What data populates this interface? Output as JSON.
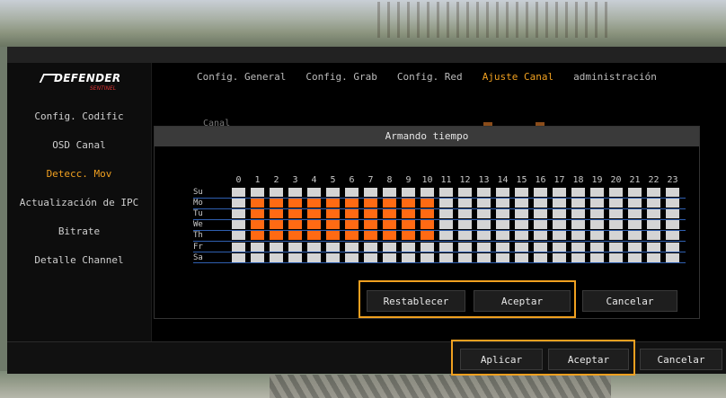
{
  "logo": {
    "brand": "DEFENDER",
    "sub": "SENTINEL"
  },
  "nav": {
    "tabs": [
      {
        "label": "Config. General",
        "active": false
      },
      {
        "label": "Config. Grab",
        "active": false
      },
      {
        "label": "Config. Red",
        "active": false
      },
      {
        "label": "Ajuste Canal",
        "active": true
      },
      {
        "label": "administración",
        "active": false
      }
    ]
  },
  "sidebar": {
    "items": [
      {
        "label": "Config. Codific",
        "active": false
      },
      {
        "label": "OSD Canal",
        "active": false
      },
      {
        "label": "Detecc. Mov",
        "active": true
      },
      {
        "label": "Actualización de IPC",
        "active": false
      },
      {
        "label": "Bitrate",
        "active": false
      },
      {
        "label": "Detalle Channel",
        "active": false
      }
    ]
  },
  "background_field_label": "Canal",
  "dialog": {
    "title": "Armando tiempo",
    "hours": [
      "0",
      "1",
      "2",
      "3",
      "4",
      "5",
      "6",
      "7",
      "8",
      "9",
      "10",
      "11",
      "12",
      "13",
      "14",
      "15",
      "16",
      "17",
      "18",
      "19",
      "20",
      "21",
      "22",
      "23"
    ],
    "days": [
      "Su",
      "Mo",
      "Tu",
      "We",
      "Th",
      "Fr",
      "Sa"
    ],
    "schedule": [
      [
        0,
        0,
        0,
        0,
        0,
        0,
        0,
        0,
        0,
        0,
        0,
        0,
        0,
        0,
        0,
        0,
        0,
        0,
        0,
        0,
        0,
        0,
        0,
        0
      ],
      [
        0,
        1,
        1,
        1,
        1,
        1,
        1,
        1,
        1,
        1,
        1,
        0,
        0,
        0,
        0,
        0,
        0,
        0,
        0,
        0,
        0,
        0,
        0,
        0
      ],
      [
        0,
        1,
        1,
        1,
        1,
        1,
        1,
        1,
        1,
        1,
        1,
        0,
        0,
        0,
        0,
        0,
        0,
        0,
        0,
        0,
        0,
        0,
        0,
        0
      ],
      [
        0,
        1,
        1,
        1,
        1,
        1,
        1,
        1,
        1,
        1,
        1,
        0,
        0,
        0,
        0,
        0,
        0,
        0,
        0,
        0,
        0,
        0,
        0,
        0
      ],
      [
        0,
        1,
        1,
        1,
        1,
        1,
        1,
        1,
        1,
        1,
        1,
        0,
        0,
        0,
        0,
        0,
        0,
        0,
        0,
        0,
        0,
        0,
        0,
        0
      ],
      [
        0,
        0,
        0,
        0,
        0,
        0,
        0,
        0,
        0,
        0,
        0,
        0,
        0,
        0,
        0,
        0,
        0,
        0,
        0,
        0,
        0,
        0,
        0,
        0
      ],
      [
        0,
        0,
        0,
        0,
        0,
        0,
        0,
        0,
        0,
        0,
        0,
        0,
        0,
        0,
        0,
        0,
        0,
        0,
        0,
        0,
        0,
        0,
        0,
        0
      ]
    ],
    "buttons": {
      "reset": "Restablecer",
      "accept": "Aceptar",
      "cancel": "Cancelar"
    }
  },
  "footer": {
    "apply": "Aplicar",
    "accept": "Aceptar",
    "cancel": "Cancelar"
  },
  "colors": {
    "accent": "#f0a020",
    "active_cell": "#ff6a13",
    "inactive_cell": "#d4d4d4",
    "grid_line": "#2f5fb0"
  }
}
